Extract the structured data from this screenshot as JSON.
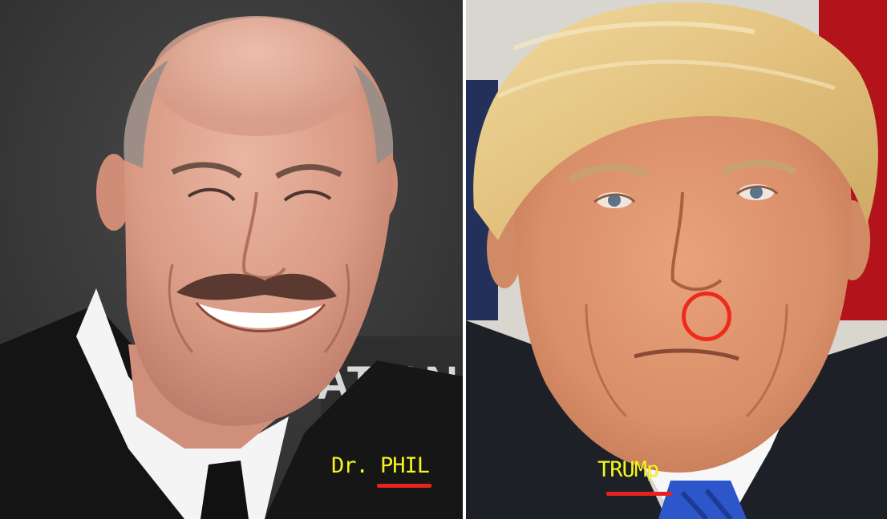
{
  "captions": {
    "left": "Dr. PHIL",
    "right": "TRUMp"
  },
  "background_sign_text": "ATION",
  "colors": {
    "caption": "#f6f51e",
    "annotation_red": "#e8221f",
    "left_backdrop": "#3a3a3a"
  }
}
